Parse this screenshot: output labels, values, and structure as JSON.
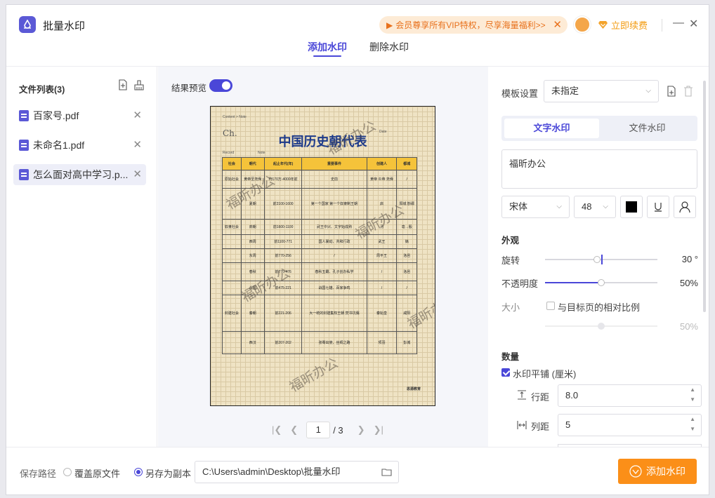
{
  "app": {
    "title": "批量水印"
  },
  "promo": {
    "text": "会员尊享所有VIP特权，尽享海量福利>>"
  },
  "renew": {
    "label": "立即续费"
  },
  "tabs": [
    "添加水印",
    "删除水印"
  ],
  "file_list": {
    "heading": "文件列表(3)",
    "files": [
      "百家号.pdf",
      "未命名1.pdf",
      "怎么面对高中学习.p..."
    ]
  },
  "preview": {
    "label": "结果预览",
    "doc": {
      "breadcrumb": "Content > Note",
      "ch": "Ch.",
      "date": "Date",
      "title": "中国历史朝代表",
      "record": "Record",
      "note": "Note",
      "headers": [
        "社会",
        "朝代",
        "起止年代(年)",
        "重要事件",
        "创建人",
        "都城"
      ],
      "rows": [
        [
          "原始社会",
          "黄帝至尧舜",
          "约170万-4000年前",
          "史前",
          "黄帝 炎帝 尧舜",
          "/"
        ],
        [
          "",
          "夏朝",
          "前2100-1600",
          "第一个国家 第一个奴隶制王朝",
          "启",
          "阳城 斟鄩"
        ],
        [
          "奴隶社会",
          "商朝",
          "前1600-1100",
          "武王中兴、文字始成熟",
          "汤",
          "亳→殷"
        ],
        [
          "",
          "西周",
          "前1100-771",
          "国人暴动、共和行政",
          "武王",
          "镐"
        ],
        [
          "",
          "东周",
          "前770-256",
          "/",
          "周平王",
          "洛邑"
        ],
        [
          "",
          "春秋",
          "前770-476",
          "春秋五霸、孔子创办私学",
          "/",
          "洛邑"
        ],
        [
          "",
          "战国",
          "前475-221",
          "战国七雄、百家争鸣",
          "/",
          "/"
        ],
        [
          "封建社会",
          "秦朝",
          "前221-206",
          "大一统的封建集权王朝 焚书坑儒",
          "秦始皇",
          "咸阳"
        ],
        [
          "",
          "西汉",
          "前207-202",
          "张骞出使、丝绸之路",
          "项羽",
          "彭城"
        ]
      ],
      "footer": "思源教育",
      "watermark": "福昕办公"
    },
    "page_current": "1",
    "page_total": "/ 3"
  },
  "settings": {
    "template_label": "模板设置",
    "template_value": "未指定",
    "wm_tabs": [
      "文字水印",
      "文件水印"
    ],
    "text": "福昕办公",
    "font": "宋体",
    "size": "48",
    "color": "#000000",
    "appearance_heading": "外观",
    "rotate_label": "旋转",
    "rotate_value": "30 °",
    "rotate_level": 0.46,
    "opacity_label": "不透明度",
    "opacity_value": "50%",
    "opacity_level": 0.5,
    "size_label": "大小",
    "relative_label": "与目标页的相对比例",
    "relative_checked": false,
    "size_value": "50%",
    "size_level": 0.5,
    "quantity_heading": "数量",
    "tile_label": "水印平铺 (厘米)",
    "tile_checked": true,
    "row_gap_label": "行距",
    "row_gap_value": "8.0",
    "col_gap_label": "列距",
    "col_gap_value": "5"
  },
  "bottom": {
    "save_path_label": "保存路径",
    "overwrite_label": "覆盖原文件",
    "save_copy_label": "另存为副本",
    "save_mode": "copy",
    "path": "C:\\Users\\admin\\Desktop\\批量水印",
    "add_button": "添加水印"
  },
  "colors": {
    "accent": "#4a47d8",
    "orange": "#fb8f18",
    "promo_bg": "#fdebd6"
  },
  "icons": [
    "app-logo-icon",
    "speaker-icon",
    "close-icon",
    "avatar-icon",
    "diamond-icon",
    "minimize-icon",
    "add-file-icon",
    "clear-icon",
    "pdf-file-icon",
    "caret-down-icon",
    "new-template-icon",
    "delete-icon",
    "underline-icon",
    "user-icon",
    "folder-icon",
    "heart-icon"
  ]
}
